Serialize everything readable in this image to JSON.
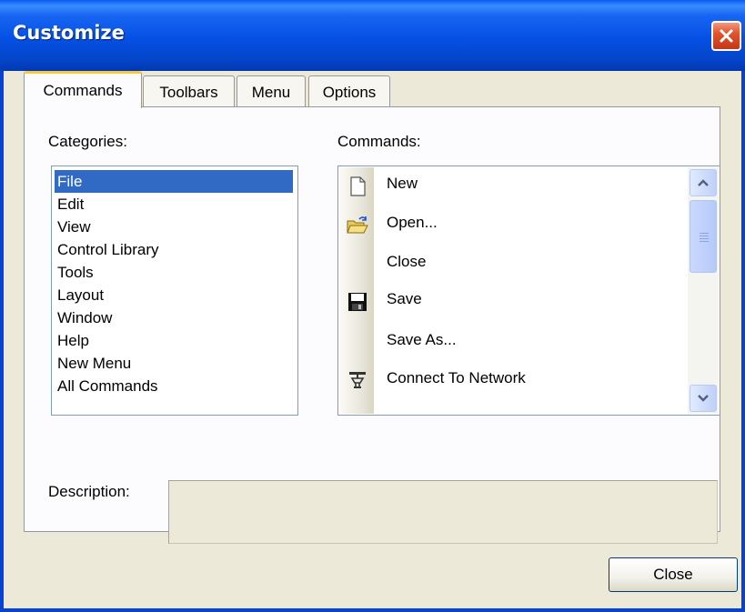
{
  "window": {
    "title": "Customize"
  },
  "tabs": [
    {
      "label": "Commands",
      "active": true
    },
    {
      "label": "Toolbars",
      "active": false
    },
    {
      "label": "Menu",
      "active": false
    },
    {
      "label": "Options",
      "active": false
    }
  ],
  "categories": {
    "label": "Categories:",
    "selected": "File",
    "items": [
      "File",
      "Edit",
      "View",
      "Control Library",
      "Tools",
      "Layout",
      "Window",
      "Help",
      "New Menu",
      "All Commands"
    ]
  },
  "commands": {
    "label": "Commands:",
    "items": [
      {
        "label": "New",
        "icon": "new-document-icon"
      },
      {
        "label": "Open...",
        "icon": "open-folder-icon"
      },
      {
        "label": "Close",
        "icon": ""
      },
      {
        "label": "Save",
        "icon": "save-disk-icon"
      },
      {
        "label": "Save As...",
        "icon": ""
      },
      {
        "label": "Connect To Network",
        "icon": "network-connect-icon"
      }
    ]
  },
  "description": {
    "label": "Description:",
    "value": ""
  },
  "footer": {
    "close_label": "Close"
  },
  "colors": {
    "title_bar": "#0550E4",
    "selection": "#316AC5",
    "active_tab_accent": "#FFC83C",
    "close_button": "#E0532E"
  }
}
